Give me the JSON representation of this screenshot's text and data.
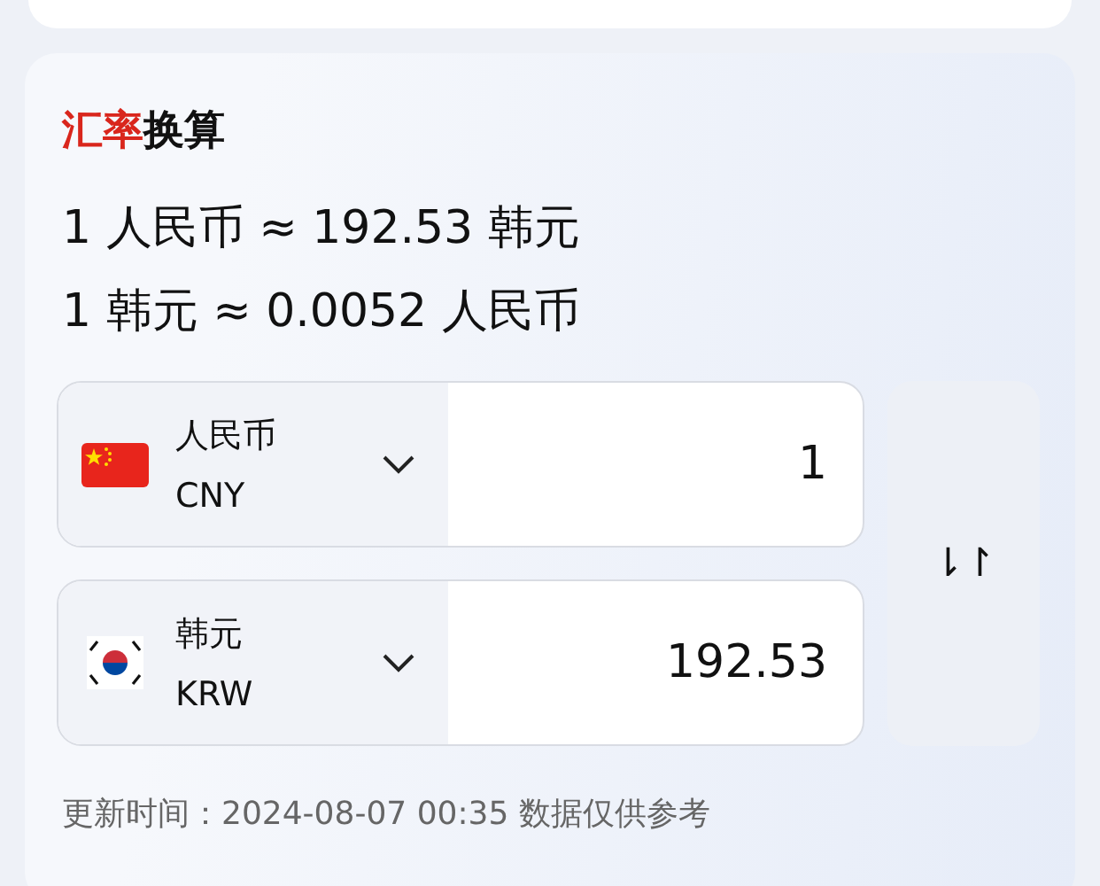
{
  "card": {
    "title": {
      "accent": "汇率",
      "rest": "换算"
    },
    "rates": [
      "1 人民币 ≈ 192.53 韩元",
      "1 韩元 ≈ 0.0052 人民币"
    ],
    "currencies": [
      {
        "kind": "cn",
        "name": "人民币",
        "code": "CNY",
        "amount": "1"
      },
      {
        "kind": "kr",
        "name": "韩元",
        "code": "KRW",
        "amount": "192.53"
      }
    ],
    "swap_icon": "⇂↾",
    "footer": "更新时间：2024-08-07 00:35 数据仅供参考"
  }
}
